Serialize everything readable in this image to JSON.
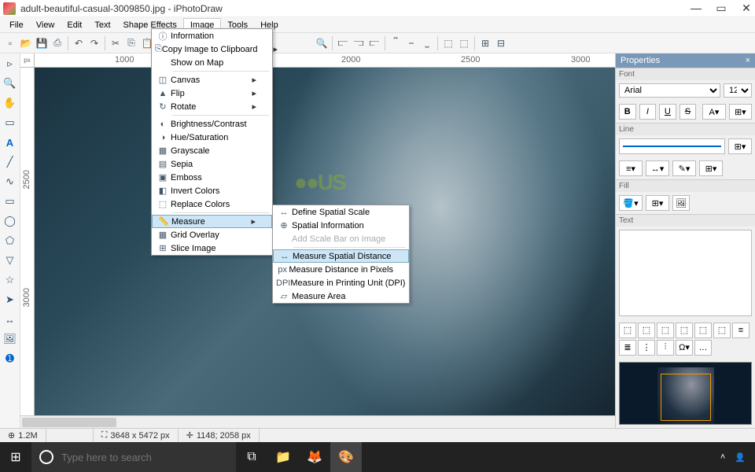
{
  "title": "adult-beautiful-casual-3009850.jpg - iPhotoDraw",
  "menubar": [
    "File",
    "View",
    "Edit",
    "Text",
    "Shape Effects",
    "Image",
    "Tools",
    "Help"
  ],
  "ruler_h": {
    "unit": "px",
    "marks": [
      {
        "pos": 120,
        "label": "1000"
      },
      {
        "pos": 408,
        "label": "2000"
      },
      {
        "pos": 560,
        "label": "2500"
      },
      {
        "pos": 700,
        "label": "3000"
      }
    ]
  },
  "ruler_v": {
    "marks": [
      {
        "pos": 130,
        "label": "2500"
      },
      {
        "pos": 280,
        "label": "3000"
      }
    ]
  },
  "menu_image": [
    {
      "icon": "ⓘ",
      "label": "Information"
    },
    {
      "icon": "⎘",
      "label": "Copy Image to Clipboard",
      "arrow": true
    },
    {
      "icon": "",
      "label": "Show on Map"
    },
    {
      "sep": true
    },
    {
      "icon": "◫",
      "label": "Canvas",
      "arrow": true
    },
    {
      "icon": "▲",
      "label": "Flip",
      "arrow": true
    },
    {
      "icon": "↻",
      "label": "Rotate",
      "arrow": true
    },
    {
      "sep": true
    },
    {
      "icon": "◐",
      "label": "Brightness/Contrast"
    },
    {
      "icon": "◑",
      "label": "Hue/Saturation"
    },
    {
      "icon": "▦",
      "label": "Grayscale"
    },
    {
      "icon": "▤",
      "label": "Sepia"
    },
    {
      "icon": "▣",
      "label": "Emboss"
    },
    {
      "icon": "◧",
      "label": "Invert Colors"
    },
    {
      "icon": "⬚",
      "label": "Replace Colors"
    },
    {
      "sep": true
    },
    {
      "icon": "📏",
      "label": "Measure",
      "arrow": true,
      "hl": true
    },
    {
      "icon": "▦",
      "label": "Grid Overlay"
    },
    {
      "icon": "⊞",
      "label": "Slice Image"
    }
  ],
  "submenu_measure": [
    {
      "icon": "↔",
      "label": "Define Spatial Scale"
    },
    {
      "icon": "⊕",
      "label": "Spatial Information"
    },
    {
      "icon": "",
      "label": "Add Scale Bar on Image",
      "disabled": true
    },
    {
      "sep": true
    },
    {
      "icon": "↔",
      "label": "Measure Spatial Distance",
      "hl": true
    },
    {
      "icon": "px",
      "label": "Measure Distance in Pixels"
    },
    {
      "icon": "DPI",
      "label": "Measure in Printing Unit (DPI)"
    },
    {
      "icon": "▱",
      "label": "Measure Area"
    }
  ],
  "properties": {
    "title": "Properties",
    "font": {
      "section": "Font",
      "name": "Arial",
      "size": "12"
    },
    "line": {
      "section": "Line"
    },
    "fill": {
      "section": "Fill"
    },
    "text": {
      "section": "Text"
    }
  },
  "status": {
    "zoom": "1.2M",
    "dims": "3648 x 5472 px",
    "cursor": "1148; 2058 px"
  },
  "taskbar": {
    "search_ph": "Type here to search"
  }
}
